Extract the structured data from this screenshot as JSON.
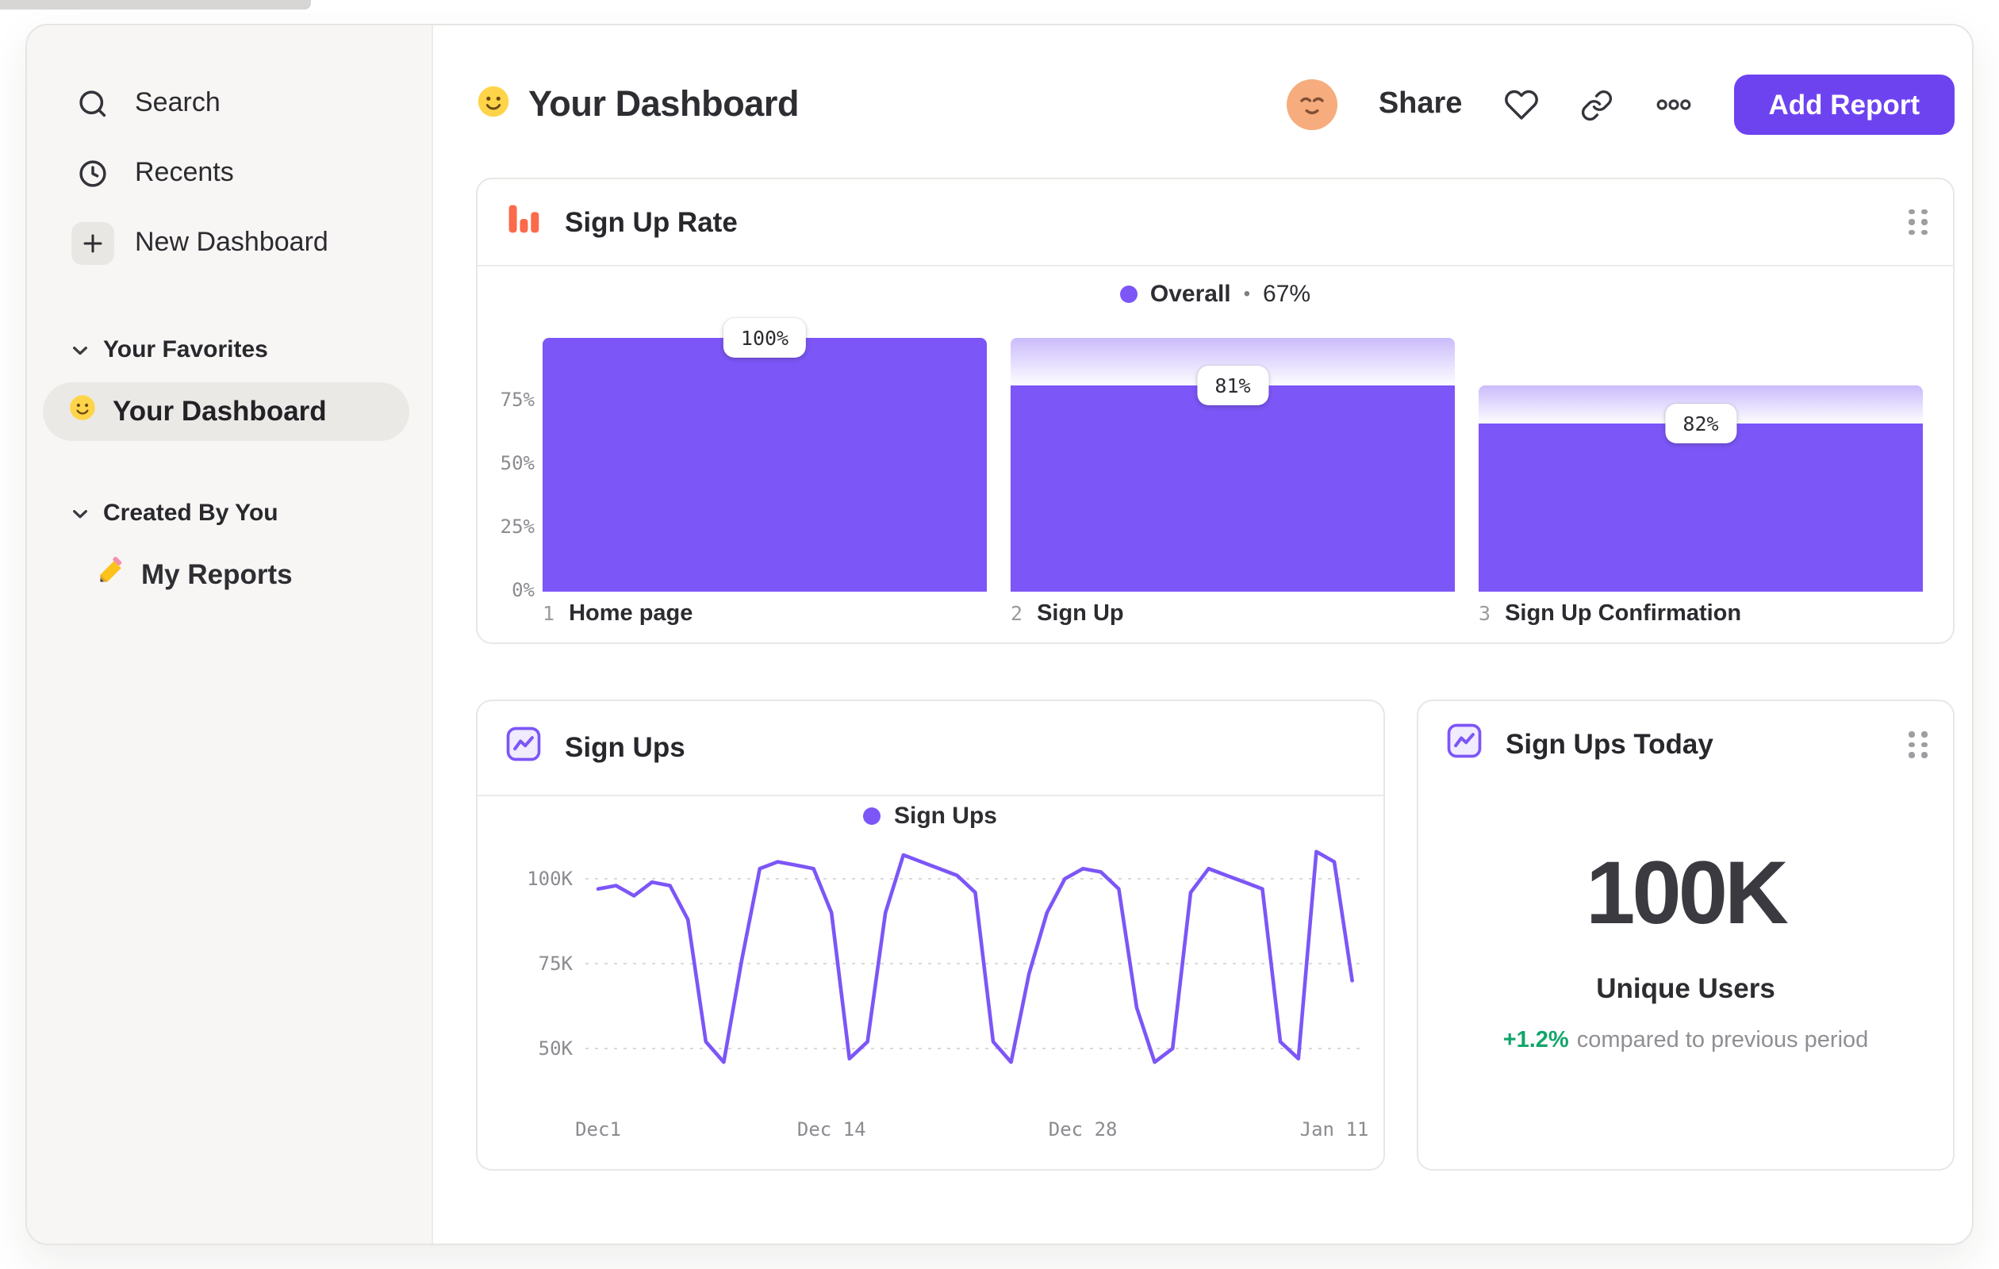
{
  "sidebar": {
    "nav": [
      {
        "label": "Search",
        "icon": "search-icon"
      },
      {
        "label": "Recents",
        "icon": "clock-icon"
      },
      {
        "label": "New Dashboard",
        "icon": "plus-icon"
      }
    ],
    "sections": [
      {
        "title": "Your Favorites",
        "items": [
          {
            "label": "Your Dashboard",
            "icon": "smiley-icon",
            "selected": true
          }
        ]
      },
      {
        "title": "Created By You",
        "items": [
          {
            "label": "My Reports",
            "icon": "pencil-icon",
            "selected": false
          }
        ]
      }
    ]
  },
  "header": {
    "title": "Your Dashboard",
    "title_icon": "smiley-icon",
    "avatar": "relieved-face-avatar",
    "share_label": "Share",
    "add_report_label": "Add Report"
  },
  "colors": {
    "accent_purple": "#7C56F7",
    "button_purple": "#6D43F0",
    "funnel_icon_orange": "#FB6A4A",
    "delta_green": "#12A56B"
  },
  "chart_data": [
    {
      "id": "sign_up_rate_funnel",
      "type": "bar",
      "variant": "funnel",
      "title": "Sign Up Rate",
      "legend": {
        "label": "Overall",
        "separator": "•",
        "value": "67%"
      },
      "y_ticks": [
        "75%",
        "50%",
        "25%",
        "0%"
      ],
      "ylim": [
        0,
        100
      ],
      "bar_color": "#7C56F7",
      "steps": [
        {
          "index": "1",
          "label": "Home page",
          "value_label": "100%",
          "step_percent": 100,
          "cumulative_percent": 100
        },
        {
          "index": "2",
          "label": "Sign Up",
          "value_label": "81%",
          "step_percent": 81,
          "cumulative_percent": 81
        },
        {
          "index": "3",
          "label": "Sign Up Confirmation",
          "value_label": "82%",
          "step_percent": 82,
          "cumulative_percent": 66.4
        }
      ]
    },
    {
      "id": "sign_ups_line",
      "type": "line",
      "title": "Sign Ups",
      "legend": {
        "label": "Sign Ups"
      },
      "line_color": "#7C56F7",
      "unit": "K",
      "ylim": [
        40,
        112
      ],
      "x_ticks": [
        {
          "label": "Dec1",
          "day": 0
        },
        {
          "label": "Dec 14",
          "day": 13
        },
        {
          "label": "Dec 28",
          "day": 27
        },
        {
          "label": "Jan 11",
          "day": 41
        }
      ],
      "y_ticks": [
        {
          "label": "100K",
          "value": 100
        },
        {
          "label": "75K",
          "value": 75
        },
        {
          "label": "50K",
          "value": 50
        }
      ],
      "points": [
        [
          0,
          97
        ],
        [
          1,
          98
        ],
        [
          2,
          95
        ],
        [
          3,
          99
        ],
        [
          4,
          98
        ],
        [
          5,
          88
        ],
        [
          6,
          52
        ],
        [
          7,
          46
        ],
        [
          8,
          76
        ],
        [
          9,
          103
        ],
        [
          10,
          105
        ],
        [
          11,
          104
        ],
        [
          12,
          103
        ],
        [
          13,
          90
        ],
        [
          14,
          47
        ],
        [
          15,
          52
        ],
        [
          16,
          90
        ],
        [
          17,
          107
        ],
        [
          18,
          105
        ],
        [
          19,
          103
        ],
        [
          20,
          101
        ],
        [
          21,
          96
        ],
        [
          22,
          52
        ],
        [
          23,
          46
        ],
        [
          24,
          72
        ],
        [
          25,
          90
        ],
        [
          26,
          100
        ],
        [
          27,
          103
        ],
        [
          28,
          102
        ],
        [
          29,
          97
        ],
        [
          30,
          62
        ],
        [
          31,
          46
        ],
        [
          32,
          50
        ],
        [
          33,
          96
        ],
        [
          34,
          103
        ],
        [
          35,
          101
        ],
        [
          36,
          99
        ],
        [
          37,
          97
        ],
        [
          38,
          52
        ],
        [
          39,
          47
        ],
        [
          40,
          108
        ],
        [
          41,
          105
        ],
        [
          42,
          70
        ]
      ]
    },
    {
      "id": "sign_ups_today",
      "type": "big_number",
      "title": "Sign Ups Today",
      "value": "100K",
      "label": "Unique Users",
      "delta": "+1.2%",
      "delta_text": "compared to previous period"
    }
  ]
}
